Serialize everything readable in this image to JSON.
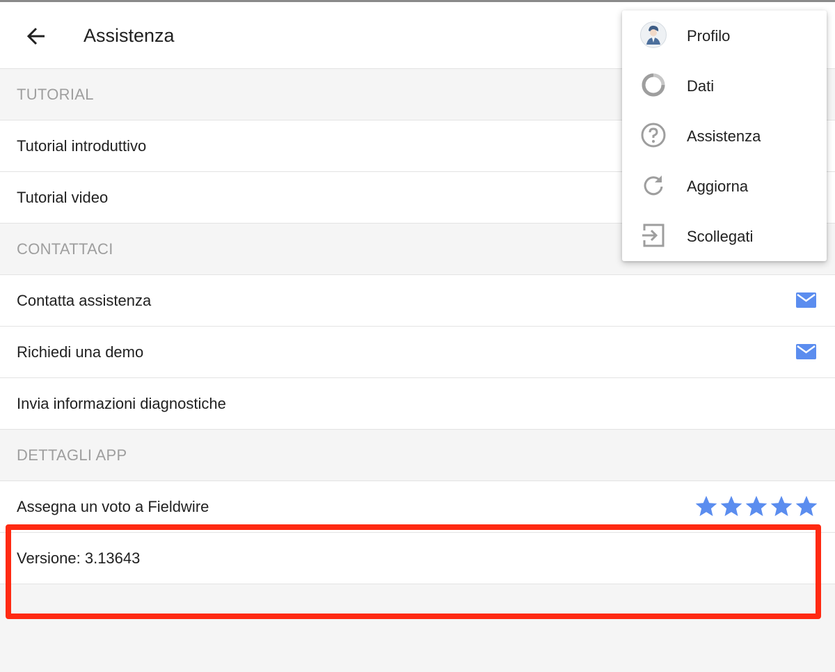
{
  "appbar": {
    "title": "Assistenza"
  },
  "sections": {
    "tutorial": {
      "header": "TUTORIAL",
      "items": [
        "Tutorial introduttivo",
        "Tutorial video"
      ]
    },
    "contact": {
      "header": "CONTATTACI",
      "items": [
        "Contatta assistenza",
        "Richiedi una demo",
        "Invia informazioni diagnostiche"
      ]
    },
    "app_details": {
      "header": "DETTAGLI APP",
      "rate_label": "Assegna un voto a Fieldwire",
      "rating_stars": 5,
      "version_label": "Versione: 3.13643"
    }
  },
  "menu": {
    "items": [
      {
        "label": "Profilo",
        "icon": "avatar-icon"
      },
      {
        "label": "Dati",
        "icon": "data-ring-icon"
      },
      {
        "label": "Assistenza",
        "icon": "help-circle-icon"
      },
      {
        "label": "Aggiorna",
        "icon": "refresh-icon"
      },
      {
        "label": "Scollegati",
        "icon": "logout-icon"
      }
    ]
  },
  "colors": {
    "accent_blue": "#5b8def",
    "annotation_red": "#ff2a12",
    "header_text": "#9e9e9e",
    "icon_gray": "#9e9e9e"
  }
}
